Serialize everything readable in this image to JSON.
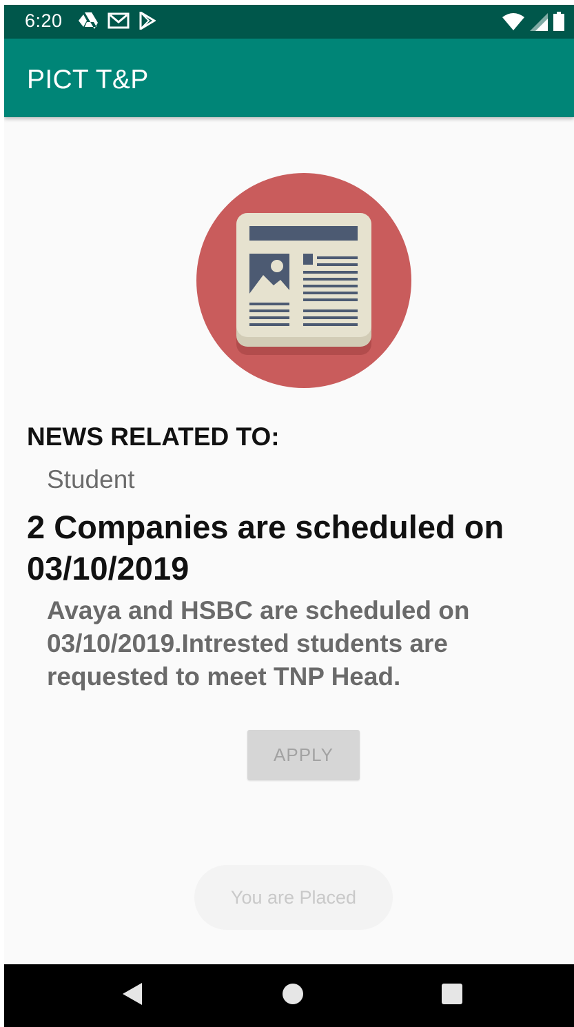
{
  "status_bar": {
    "time": "6:20",
    "icons": [
      "drive-icon",
      "gmail-icon",
      "play-store-icon",
      "wifi-icon",
      "signal-icon",
      "battery-icon"
    ]
  },
  "app_bar": {
    "title": "PICT T&P",
    "color": "#008577",
    "status_color": "#00574b"
  },
  "news": {
    "image_icon": "newspaper-icon",
    "section_label": "NEWS RELATED TO:",
    "category": "Student",
    "headline": "2 Companies are scheduled on 03/10/2019",
    "body": "Avaya and HSBC are scheduled on 03/10/2019.Intrested students are requested to meet TNP Head.",
    "apply_label": "APPLY"
  },
  "toast": {
    "message": "You are Placed"
  },
  "nav_bar": {
    "icons": [
      "back-icon",
      "home-icon",
      "recents-icon"
    ]
  },
  "colors": {
    "circle": "#c95c5c",
    "paper": "#e6e2cf",
    "ink": "#4c5a72"
  }
}
